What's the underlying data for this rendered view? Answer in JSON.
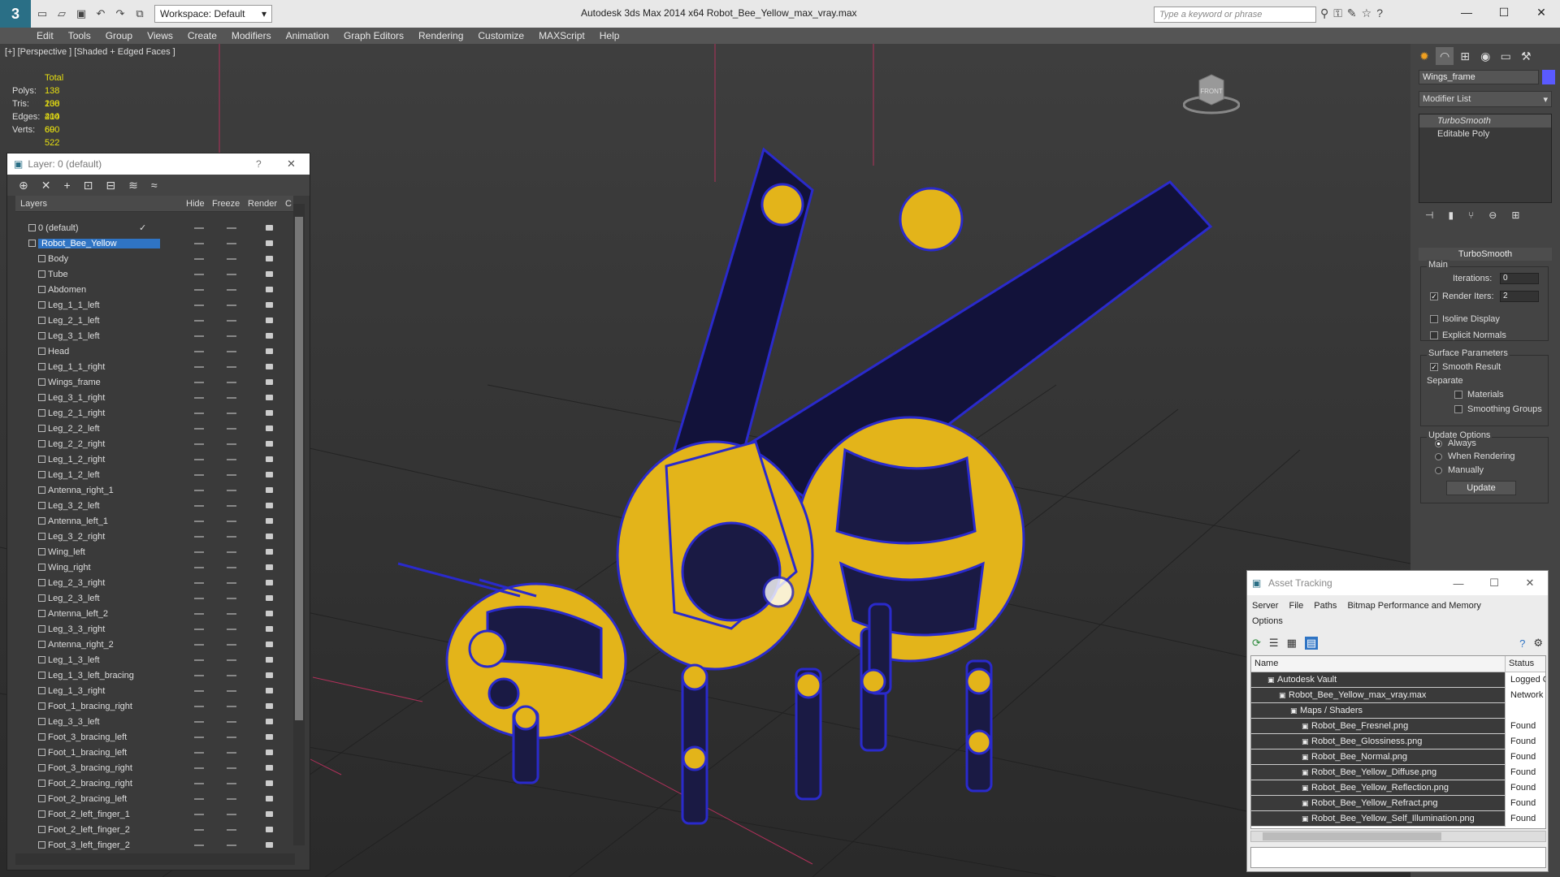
{
  "titlebar": {
    "logo": "3",
    "workspace": "Workspace: Default",
    "title": "Autodesk 3ds Max  2014 x64     Robot_Bee_Yellow_max_vray.max",
    "search_placeholder": "Type a keyword or phrase"
  },
  "menu": [
    "Edit",
    "Tools",
    "Group",
    "Views",
    "Create",
    "Modifiers",
    "Animation",
    "Graph Editors",
    "Rendering",
    "Customize",
    "MAXScript",
    "Help"
  ],
  "viewport": {
    "label": "[+] [Perspective ] [Shaded + Edged Faces ]",
    "stats": {
      "header": "Total",
      "rows": [
        {
          "k": "Polys:",
          "v": "138 200"
        },
        {
          "k": "Tris:",
          "v": "138 200"
        },
        {
          "k": "Edges:",
          "v": "414 600"
        },
        {
          "k": "Verts:",
          "v": "69 522"
        }
      ]
    },
    "viewcube_label": "FRONT"
  },
  "layer_panel": {
    "title": "Layer: 0 (default)",
    "help": "?",
    "close": "✕",
    "headers": {
      "layers": "Layers",
      "hide": "Hide",
      "freeze": "Freeze",
      "render": "Render",
      "c": "C"
    },
    "layers": [
      {
        "name": "0 (default)",
        "level": 0
      },
      {
        "name": "Robot_Bee_Yellow",
        "level": 0,
        "selected": true
      },
      {
        "name": "Body",
        "level": 1
      },
      {
        "name": "Tube",
        "level": 1
      },
      {
        "name": "Abdomen",
        "level": 1
      },
      {
        "name": "Leg_1_1_left",
        "level": 1
      },
      {
        "name": "Leg_2_1_left",
        "level": 1
      },
      {
        "name": "Leg_3_1_left",
        "level": 1
      },
      {
        "name": "Head",
        "level": 1
      },
      {
        "name": "Leg_1_1_right",
        "level": 1
      },
      {
        "name": "Wings_frame",
        "level": 1
      },
      {
        "name": "Leg_3_1_right",
        "level": 1
      },
      {
        "name": "Leg_2_1_right",
        "level": 1
      },
      {
        "name": "Leg_2_2_left",
        "level": 1
      },
      {
        "name": "Leg_2_2_right",
        "level": 1
      },
      {
        "name": "Leg_1_2_right",
        "level": 1
      },
      {
        "name": "Leg_1_2_left",
        "level": 1
      },
      {
        "name": "Antenna_right_1",
        "level": 1
      },
      {
        "name": "Leg_3_2_left",
        "level": 1
      },
      {
        "name": "Antenna_left_1",
        "level": 1
      },
      {
        "name": "Leg_3_2_right",
        "level": 1
      },
      {
        "name": "Wing_left",
        "level": 1
      },
      {
        "name": "Wing_right",
        "level": 1
      },
      {
        "name": "Leg_2_3_right",
        "level": 1
      },
      {
        "name": "Leg_2_3_left",
        "level": 1
      },
      {
        "name": "Antenna_left_2",
        "level": 1
      },
      {
        "name": "Leg_3_3_right",
        "level": 1
      },
      {
        "name": "Antenna_right_2",
        "level": 1
      },
      {
        "name": "Leg_1_3_left",
        "level": 1
      },
      {
        "name": "Leg_1_3_left_bracing",
        "level": 1
      },
      {
        "name": "Leg_1_3_right",
        "level": 1
      },
      {
        "name": "Foot_1_bracing_right",
        "level": 1
      },
      {
        "name": "Leg_3_3_left",
        "level": 1
      },
      {
        "name": "Foot_3_bracing_left",
        "level": 1
      },
      {
        "name": "Foot_1_bracing_left",
        "level": 1
      },
      {
        "name": "Foot_3_bracing_right",
        "level": 1
      },
      {
        "name": "Foot_2_bracing_right",
        "level": 1
      },
      {
        "name": "Foot_2_bracing_left",
        "level": 1
      },
      {
        "name": "Foot_2_left_finger_1",
        "level": 1
      },
      {
        "name": "Foot_2_left_finger_2",
        "level": 1
      },
      {
        "name": "Foot_3_left_finger_2",
        "level": 1
      }
    ]
  },
  "command_panel": {
    "object_name": "Wings_frame",
    "object_color": "#5a5aff",
    "modifier_list": "Modifier List",
    "stack": [
      "TurboSmooth",
      "Editable Poly"
    ],
    "rollout_title": "TurboSmooth",
    "main_label": "Main",
    "iterations_label": "Iterations:",
    "iterations": "0",
    "render_iters_label": "Render Iters:",
    "render_iters": "2",
    "isoline": "Isoline Display",
    "explicit_normals": "Explicit Normals",
    "surface_params": "Surface Parameters",
    "smooth_result": "Smooth Result",
    "separate": "Separate",
    "materials": "Materials",
    "smoothing_groups": "Smoothing Groups",
    "update_options": "Update Options",
    "always": "Always",
    "when_rendering": "When Rendering",
    "manually": "Manually",
    "update_btn": "Update"
  },
  "asset_tracking": {
    "title": "Asset Tracking",
    "menu1": [
      "Server",
      "File",
      "Paths",
      "Bitmap Performance and Memory"
    ],
    "menu2": [
      "Options"
    ],
    "headers": {
      "name": "Name",
      "status": "Status"
    },
    "rows": [
      {
        "name": "Autodesk Vault",
        "status": "Logged Ou",
        "indent": 20,
        "dark": true
      },
      {
        "name": "Robot_Bee_Yellow_max_vray.max",
        "status": "Network P",
        "indent": 34,
        "dark": true
      },
      {
        "name": "Maps / Shaders",
        "status": "",
        "indent": 48,
        "dark": true
      },
      {
        "name": "Robot_Bee_Fresnel.png",
        "status": "Found",
        "indent": 62,
        "dark": true
      },
      {
        "name": "Robot_Bee_Glossiness.png",
        "status": "Found",
        "indent": 62,
        "dark": true
      },
      {
        "name": "Robot_Bee_Normal.png",
        "status": "Found",
        "indent": 62,
        "dark": true
      },
      {
        "name": "Robot_Bee_Yellow_Diffuse.png",
        "status": "Found",
        "indent": 62,
        "dark": true
      },
      {
        "name": "Robot_Bee_Yellow_Reflection.png",
        "status": "Found",
        "indent": 62,
        "dark": true
      },
      {
        "name": "Robot_Bee_Yellow_Refract.png",
        "status": "Found",
        "indent": 62,
        "dark": true
      },
      {
        "name": "Robot_Bee_Yellow_Self_Illumination.png",
        "status": "Found",
        "indent": 62,
        "dark": true
      }
    ]
  }
}
